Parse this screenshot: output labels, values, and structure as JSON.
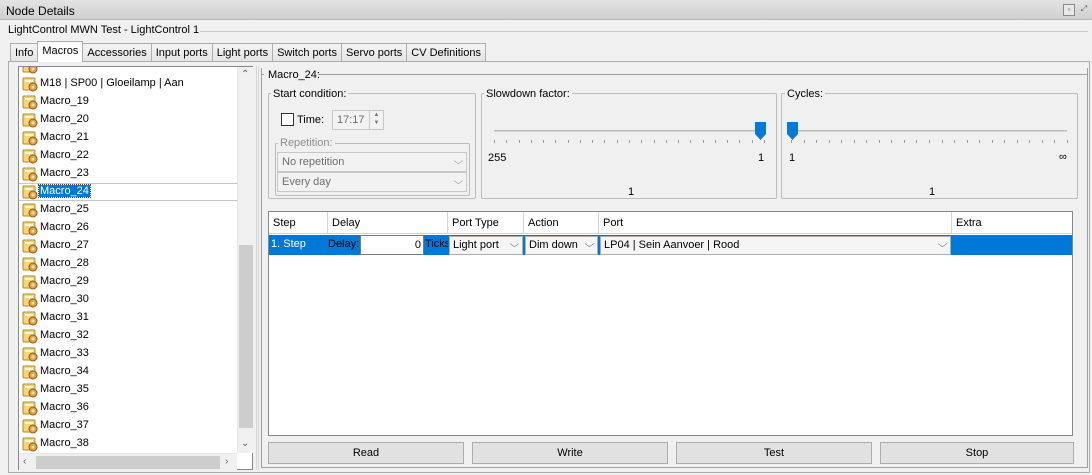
{
  "window": {
    "title": "Node Details"
  },
  "node": {
    "subtitle": "LightControl MWN Test - LightControl 1"
  },
  "tabs": [
    {
      "label": "Info"
    },
    {
      "label": "Macros"
    },
    {
      "label": "Accessories"
    },
    {
      "label": "Input ports"
    },
    {
      "label": "Light ports"
    },
    {
      "label": "Switch ports"
    },
    {
      "label": "Servo ports"
    },
    {
      "label": "CV Definitions"
    }
  ],
  "tree": {
    "items": [
      {
        "label": "M18 | SP00 | Gloeilamp | Aan"
      },
      {
        "label": "Macro_19"
      },
      {
        "label": "Macro_20"
      },
      {
        "label": "Macro_21"
      },
      {
        "label": "Macro_22"
      },
      {
        "label": "Macro_23"
      },
      {
        "label": "Macro_24"
      },
      {
        "label": "Macro_25"
      },
      {
        "label": "Macro_26"
      },
      {
        "label": "Macro_27"
      },
      {
        "label": "Macro_28"
      },
      {
        "label": "Macro_29"
      },
      {
        "label": "Macro_30"
      },
      {
        "label": "Macro_31"
      },
      {
        "label": "Macro_32"
      },
      {
        "label": "Macro_33"
      },
      {
        "label": "Macro_34"
      },
      {
        "label": "Macro_35"
      },
      {
        "label": "Macro_36"
      },
      {
        "label": "Macro_37"
      },
      {
        "label": "Macro_38"
      }
    ],
    "selected": "Macro_24"
  },
  "macro": {
    "title": "Macro_24:",
    "start_condition": {
      "label": "Start condition:",
      "time_label": "Time:",
      "time_value": "17:17",
      "repetition_label": "Repetition:",
      "repetition_value": "No repetition",
      "day_value": "Every day"
    },
    "slowdown": {
      "label": "Slowdown factor:",
      "min_label": "255",
      "max_label": "1",
      "value": "1"
    },
    "cycles": {
      "label": "Cycles:",
      "min_label": "1",
      "max_label": "∞",
      "value": "1"
    },
    "grid": {
      "headers": [
        "Step",
        "Delay",
        "Port Type",
        "Action",
        "Port",
        "Extra"
      ],
      "rows": [
        {
          "step": "1. Step",
          "delay_label": "Delay:",
          "delay_value": "0",
          "delay_unit": "Ticks",
          "port_type": "Light port",
          "action": "Dim down",
          "port": "LP04 | Sein Aanvoer | Rood",
          "extra": ""
        }
      ]
    },
    "buttons": {
      "read": "Read",
      "write": "Write",
      "test": "Test",
      "stop": "Stop"
    }
  },
  "colors": {
    "selection": "#0078d7",
    "macro_icon": "#e8c35a"
  }
}
